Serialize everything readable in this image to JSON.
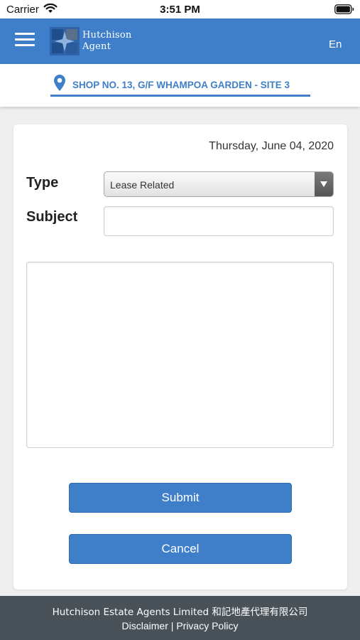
{
  "status_bar": {
    "carrier": "Carrier",
    "time": "3:51 PM"
  },
  "header": {
    "brand_line1": "Hutchison",
    "brand_line2": "Agent",
    "language": "En",
    "color": "#3f7fc9"
  },
  "location": {
    "text": "SHOP NO. 13, G/F WHAMPOA GARDEN - SITE 3"
  },
  "form": {
    "date": "Thursday, June 04, 2020",
    "type_label": "Type",
    "type_value": "Lease Related",
    "subject_label": "Subject",
    "subject_value": "",
    "message_value": "",
    "submit_label": "Submit",
    "cancel_label": "Cancel"
  },
  "footer": {
    "company": "Hutchison Estate Agents Limited 和記地產代理有限公司",
    "disclaimer": "Disclaimer",
    "separator": "|",
    "privacy": "Privacy Policy",
    "color": "#4a5259"
  }
}
